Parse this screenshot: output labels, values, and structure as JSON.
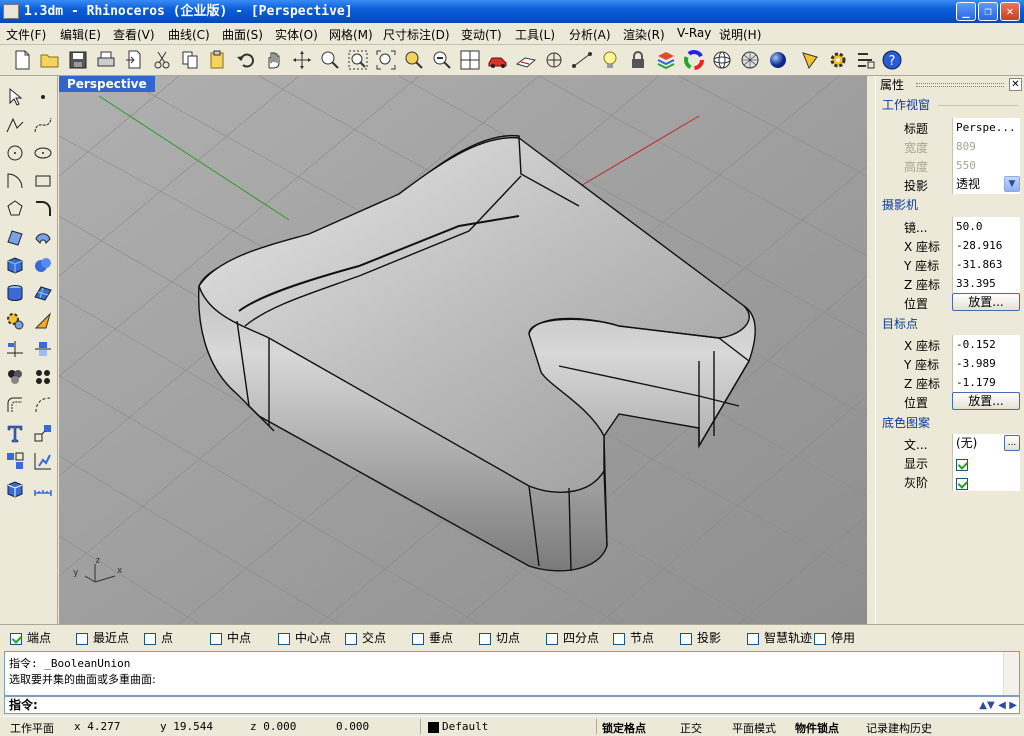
{
  "window": {
    "title": "1.3dm - Rhinoceros (企业版) - [Perspective]",
    "minimize": "_",
    "maximize": "❐",
    "close": "✕"
  },
  "menu": [
    "文件(F)",
    "编辑(E)",
    "查看(V)",
    "曲线(C)",
    "曲面(S)",
    "实体(O)",
    "网格(M)",
    "尺寸标注(D)",
    "变动(T)",
    "工具(L)",
    "分析(A)",
    "渲染(R)",
    "V-Ray",
    "说明(H)"
  ],
  "toolbar_icons": [
    "new-file-icon",
    "open-folder-icon",
    "save-icon",
    "print-icon",
    "import-icon",
    "cut-icon",
    "copy-icon",
    "paste-icon",
    "undo-icon",
    "pan-hand-icon",
    "rotate-view-icon",
    "zoom-dynamic-icon",
    "zoom-window-icon",
    "zoom-extents-icon",
    "zoom-selected-icon",
    "four-viewports-icon",
    "car-render-icon",
    "cplane-icon",
    "grid-snap-icon",
    "light-bulb-icon",
    "lock-icon",
    "layer-icon",
    "color-wheel-icon",
    "wireframe-sphere-icon",
    "mesh-sphere-icon",
    "render-sphere-icon",
    "dimension-icon",
    "settings-gear-icon",
    "options-icon",
    "help-icon"
  ],
  "left_icons": [
    "select-arrow-icon",
    "point-icon",
    "polyline-icon",
    "curve-icon",
    "circle-icon",
    "ellipse-icon",
    "arc-icon",
    "rectangle-icon",
    "polygon-icon",
    "fillet-curve-icon",
    "surface-corner-icon",
    "surface-revolve-icon",
    "box-icon",
    "sphere-icon",
    "cylinder-icon",
    "mesh-plane-icon",
    "boolean-gear-icon",
    "explode-icon",
    "trim-icon",
    "split-icon",
    "join-icon",
    "array-icon",
    "offset-icon",
    "extend-icon",
    "text-icon",
    "scale-icon",
    "group-icon",
    "analyze-icon",
    "solid-box-icon",
    "dimension-ruler-icon"
  ],
  "viewport": {
    "tab": "Perspective",
    "axis_labels": {
      "x": "x",
      "y": "y",
      "z": "z"
    }
  },
  "properties_panel": {
    "header": "属性",
    "sections": {
      "viewport": {
        "title": "工作视窗",
        "rows": [
          {
            "label": "标题",
            "value": "Perspe..."
          },
          {
            "label": "宽度",
            "value": "809",
            "disabled": true
          },
          {
            "label": "高度",
            "value": "550",
            "disabled": true
          },
          {
            "label": "投影",
            "value": "透视",
            "dropdown": true
          }
        ]
      },
      "camera": {
        "title": "摄影机",
        "rows": [
          {
            "label": "镜...",
            "value": "50.0"
          },
          {
            "label": "X 座标",
            "value": "-28.916"
          },
          {
            "label": "Y 座标",
            "value": "-31.863"
          },
          {
            "label": "Z 座标",
            "value": "33.395"
          },
          {
            "label": "位置",
            "button": "放置..."
          }
        ]
      },
      "target": {
        "title": "目标点",
        "rows": [
          {
            "label": "X 座标",
            "value": "-0.152"
          },
          {
            "label": "Y 座标",
            "value": "-3.989"
          },
          {
            "label": "Z 座标",
            "value": "-1.179"
          },
          {
            "label": "位置",
            "button": "放置..."
          }
        ]
      },
      "wallpaper": {
        "title": "底色图案",
        "rows": [
          {
            "label": "文...",
            "value": "(无)",
            "more": "..."
          },
          {
            "label": "显示",
            "checked": true
          },
          {
            "label": "灰阶",
            "checked": true
          }
        ]
      }
    }
  },
  "osnap": [
    {
      "label": "端点",
      "checked": true
    },
    {
      "label": "最近点",
      "checked": false
    },
    {
      "label": "点",
      "checked": false
    },
    {
      "label": "中点",
      "checked": false
    },
    {
      "label": "中心点",
      "checked": false
    },
    {
      "label": "交点",
      "checked": false
    },
    {
      "label": "垂点",
      "checked": false
    },
    {
      "label": "切点",
      "checked": false
    },
    {
      "label": "四分点",
      "checked": false
    },
    {
      "label": "节点",
      "checked": false
    },
    {
      "label": "投影",
      "checked": false
    },
    {
      "label": "智慧轨迹",
      "checked": false
    },
    {
      "label": "停用",
      "checked": false
    }
  ],
  "command": {
    "history": [
      "指令: _BooleanUnion",
      "选取要并集的曲面或多重曲面:"
    ],
    "prompt": "指令:"
  },
  "status_bar": {
    "cplane": "工作平面",
    "x": "x 4.277",
    "y": "y 19.544",
    "z": "z 0.000",
    "extra": "0.000",
    "layer": "Default",
    "layer_color": "#000000",
    "toggles": [
      "锁定格点",
      "正交",
      "平面模式",
      "物件锁点",
      "记录建构历史"
    ]
  }
}
